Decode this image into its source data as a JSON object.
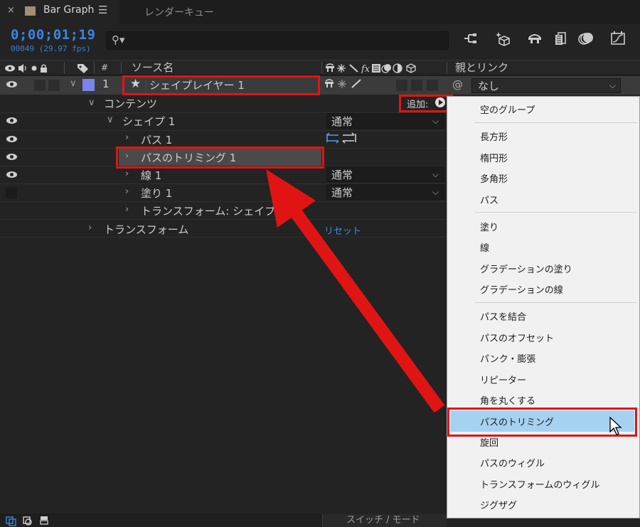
{
  "tab": {
    "close": "×",
    "title": "Bar Graph",
    "menu": "☰",
    "render_queue": "レンダーキュー"
  },
  "timecode": "0;00;01;19",
  "frames": "00049 (29.97 fps)",
  "search": {
    "placeholder": ""
  },
  "toolbar_icons": [
    "composition-flowchart-icon",
    "draft-3d-icon",
    "shy-layers-icon",
    "frame-blending-icon",
    "motion-blur-icon",
    "graph-editor-icon"
  ],
  "columns": {
    "number": "#",
    "source_name": "ソース名",
    "parent_link": "親とリンク"
  },
  "layer": {
    "number": "1",
    "name": "シェイプレイヤー 1",
    "label_color": "#7b84ea",
    "parent_value": "なし"
  },
  "tree": {
    "contents": "コンテンツ",
    "add_label": "追加:",
    "shape1": "シェイプ 1",
    "shape1_mode": "通常",
    "path1": "パス 1",
    "trim1": "パスのトリミング 1",
    "stroke1": "線 1",
    "stroke1_mode": "通常",
    "fill1": "塗り 1",
    "fill1_mode": "通常",
    "transform_shape": "トランスフォーム: シェイプ 1",
    "transform": "トランスフォーム",
    "reset": "リセット"
  },
  "menu": {
    "group": [
      "空のグループ"
    ],
    "shapes": [
      "長方形",
      "楕円形",
      "多角形",
      "パス"
    ],
    "paints": [
      "塗り",
      "線",
      "グラデーションの塗り",
      "グラデーションの線"
    ],
    "operators": [
      "パスを結合",
      "パスのオフセット",
      "パンク・膨張",
      "リピーター",
      "角を丸くする",
      "パスのトリミング",
      "旋回",
      "パスのウィグル",
      "トランスフォームのウィグル",
      "ジグザグ"
    ]
  },
  "bottom": {
    "switch_mode": "スイッチ / モード"
  },
  "colors": {
    "accent_blue": "#3b86e0",
    "highlight_red": "#e11414",
    "menu_selected": "#a6d2f2"
  }
}
